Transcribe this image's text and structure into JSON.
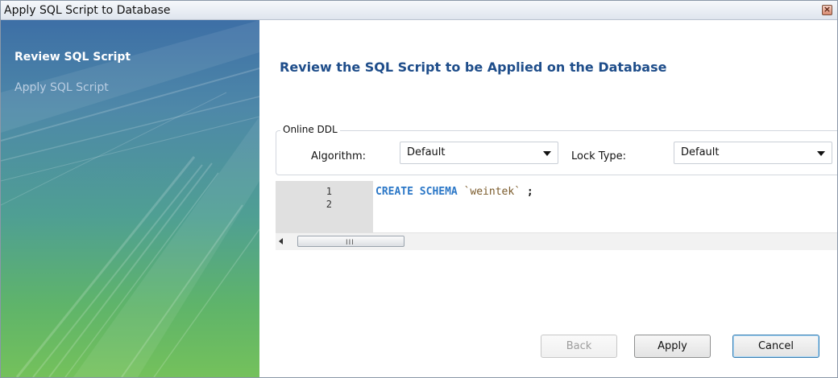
{
  "window": {
    "title": "Apply SQL Script to Database"
  },
  "sidebar": {
    "steps": [
      {
        "label": "Review SQL Script",
        "active": true
      },
      {
        "label": "Apply SQL Script",
        "active": false
      }
    ]
  },
  "main": {
    "heading": "Review the SQL Script to be Applied on the Database",
    "online_ddl": {
      "legend": "Online DDL",
      "algorithm_label": "Algorithm:",
      "algorithm_value": "Default",
      "lock_type_label": "Lock Type:",
      "lock_type_value": "Default"
    },
    "editor": {
      "line_numbers": [
        "1",
        "2"
      ],
      "line1_keyword": "CREATE SCHEMA",
      "line1_identifier": "`weintek`",
      "line1_terminator": ";",
      "scrollbar_grip": "III"
    }
  },
  "buttons": {
    "back": "Back",
    "apply": "Apply",
    "cancel": "Cancel"
  },
  "colors": {
    "heading": "#1e4d8a",
    "keyword": "#2b77c7",
    "identifier": "#7a5a2a"
  },
  "icons": {
    "close": "close-icon",
    "dropdown": "chevron-down-icon",
    "scroll_left": "arrow-left-icon"
  }
}
